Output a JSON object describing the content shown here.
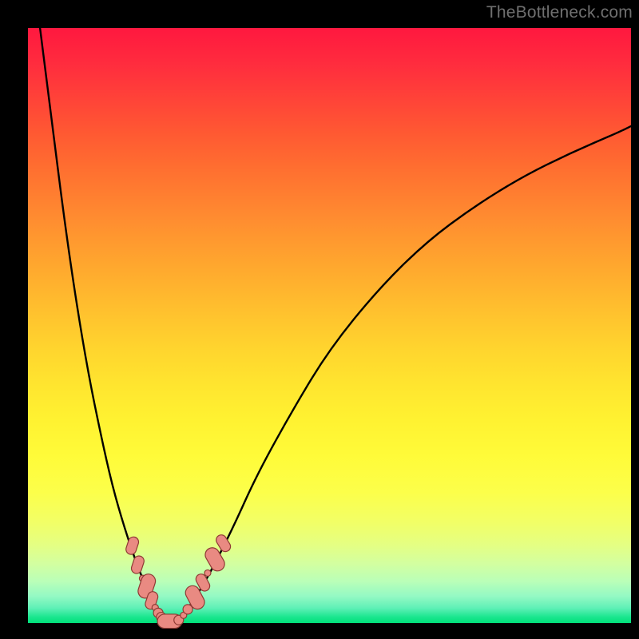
{
  "watermark": "TheBottleneck.com",
  "colors": {
    "curve": "#000000",
    "bead_fill": "#e98a82",
    "bead_stroke": "#8f3a34",
    "frame_bg": "#000000"
  },
  "chart_data": {
    "type": "line",
    "title": "",
    "xlabel": "",
    "ylabel": "",
    "xlim": [
      0,
      100
    ],
    "ylim": [
      0,
      100
    ],
    "grid": false,
    "legend": false,
    "series": [
      {
        "name": "left-branch",
        "x": [
          2,
          4,
          6,
          8,
          10,
          12,
          14,
          16,
          18,
          20,
          21,
          22,
          23
        ],
        "y": [
          100,
          84,
          68,
          54,
          42,
          32,
          23,
          16,
          10,
          5,
          3,
          1.5,
          0.5
        ]
      },
      {
        "name": "right-branch",
        "x": [
          25,
          27,
          30,
          34,
          38,
          44,
          50,
          58,
          66,
          74,
          82,
          90,
          98,
          100
        ],
        "y": [
          0.5,
          3,
          8,
          16,
          25,
          36,
          46,
          56,
          64,
          70,
          75,
          79,
          82.5,
          83.5
        ]
      }
    ],
    "markers": [
      {
        "x": 17.3,
        "y": 13.0,
        "shape": "pill",
        "angle": -72,
        "size": "m"
      },
      {
        "x": 18.2,
        "y": 9.8,
        "shape": "pill",
        "angle": -72,
        "size": "m"
      },
      {
        "x": 19.0,
        "y": 7.5,
        "shape": "dot",
        "size": "xs"
      },
      {
        "x": 19.7,
        "y": 6.2,
        "shape": "pill",
        "angle": -72,
        "size": "l"
      },
      {
        "x": 20.5,
        "y": 3.8,
        "shape": "pill",
        "angle": -72,
        "size": "m"
      },
      {
        "x": 21.1,
        "y": 2.6,
        "shape": "dot",
        "size": "xs"
      },
      {
        "x": 21.6,
        "y": 1.7,
        "shape": "dot",
        "size": "s"
      },
      {
        "x": 22.1,
        "y": 1.0,
        "shape": "dot",
        "size": "s"
      },
      {
        "x": 22.6,
        "y": 0.6,
        "shape": "dot",
        "size": "xs"
      },
      {
        "x": 23.5,
        "y": 0.3,
        "shape": "pill",
        "angle": 0,
        "size": "l"
      },
      {
        "x": 25.0,
        "y": 0.5,
        "shape": "dot",
        "size": "s"
      },
      {
        "x": 25.8,
        "y": 1.3,
        "shape": "dot",
        "size": "xs"
      },
      {
        "x": 26.5,
        "y": 2.3,
        "shape": "dot",
        "size": "s"
      },
      {
        "x": 27.7,
        "y": 4.3,
        "shape": "pill",
        "angle": 62,
        "size": "l"
      },
      {
        "x": 29.0,
        "y": 6.8,
        "shape": "pill",
        "angle": 62,
        "size": "m"
      },
      {
        "x": 29.8,
        "y": 8.4,
        "shape": "dot",
        "size": "xs"
      },
      {
        "x": 31.0,
        "y": 10.7,
        "shape": "pill",
        "angle": 60,
        "size": "l"
      },
      {
        "x": 32.4,
        "y": 13.4,
        "shape": "pill",
        "angle": 58,
        "size": "m"
      }
    ]
  }
}
